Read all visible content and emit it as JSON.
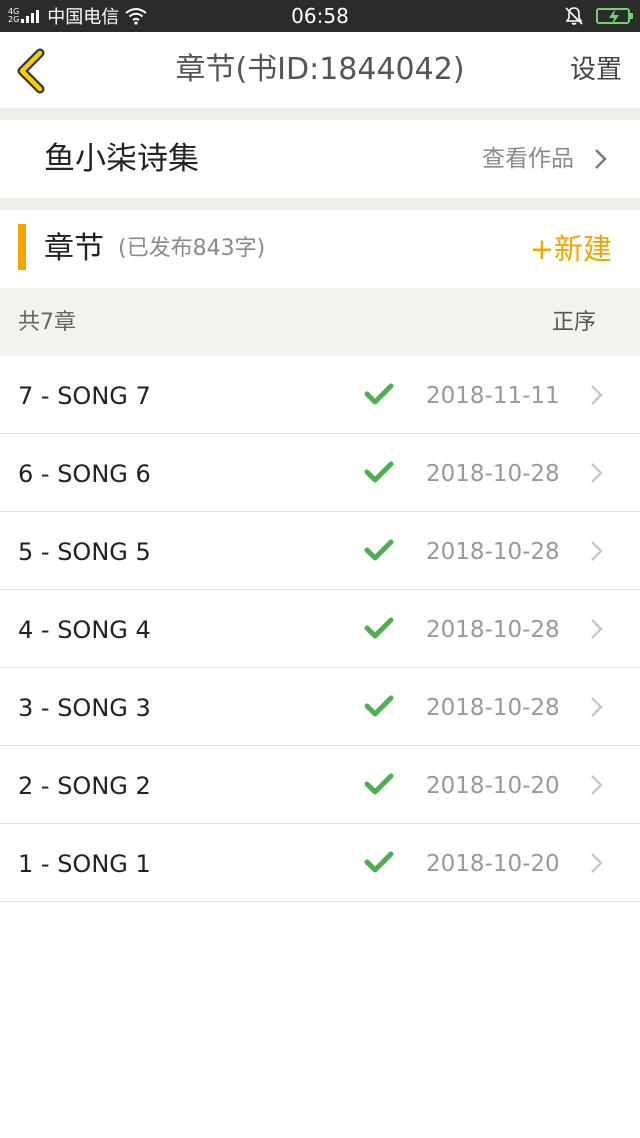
{
  "status_bar": {
    "net_top": "4G",
    "net_bottom": "2G",
    "carrier": "中国电信",
    "time": "06:58"
  },
  "nav": {
    "title": "章节(书ID:1844042)",
    "settings_label": "设置"
  },
  "book": {
    "name": "鱼小柒诗集",
    "view_works_label": "查看作品"
  },
  "chapters_header": {
    "title": "章节",
    "subtitle": "(已发布843字)",
    "new_label": "+新建"
  },
  "summary": {
    "total": "共7章",
    "order": "正序"
  },
  "chapters": [
    {
      "name": "7 - SONG 7",
      "date": "2018-11-11"
    },
    {
      "name": "6 - SONG 6",
      "date": "2018-10-28"
    },
    {
      "name": "5 - SONG 5",
      "date": "2018-10-28"
    },
    {
      "name": "4 - SONG 4",
      "date": "2018-10-28"
    },
    {
      "name": "3 - SONG 3",
      "date": "2018-10-28"
    },
    {
      "name": "2 - SONG 2",
      "date": "2018-10-20"
    },
    {
      "name": "1 - SONG 1",
      "date": "2018-10-20"
    }
  ],
  "colors": {
    "accent": "#f5a500",
    "check": "#4caf50",
    "status_bar_bg": "#2b2b2b",
    "summary_bg": "#f2f2ee"
  },
  "icons": {
    "back": "back-chevron-icon",
    "chevron": "chevron-right-icon",
    "check": "checkmark-icon",
    "wifi": "wifi-icon",
    "mute": "bell-muted-icon",
    "battery": "battery-charging-icon"
  }
}
